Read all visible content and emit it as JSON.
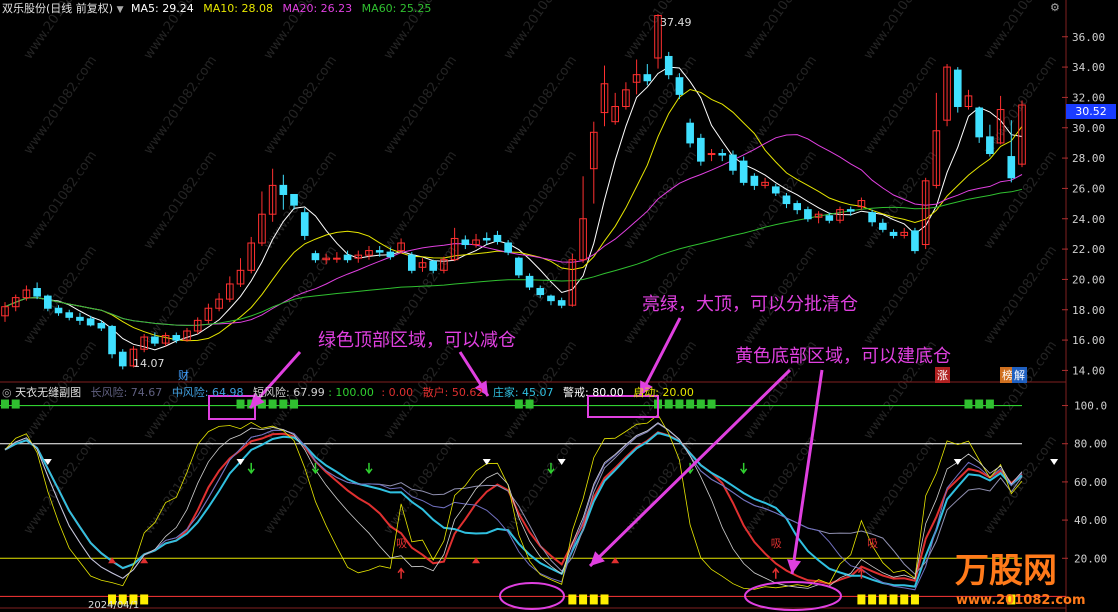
{
  "header": {
    "stock_title": "双乐股份(日线 前复权)",
    "ma5": "MA5: 29.24",
    "ma10": "MA10: 28.08",
    "ma20": "MA20: 26.23",
    "ma60": "MA60: 25.25"
  },
  "main_chart": {
    "y_ticks": [
      "36.00",
      "34.00",
      "32.00",
      "30.00",
      "28.00",
      "26.00",
      "24.00",
      "22.00",
      "20.00",
      "18.00",
      "16.00",
      "14.00"
    ],
    "current_price": "30.52",
    "high_label": "37.49",
    "low_label": "14.07",
    "caiwu_tag": "财",
    "zhang_tag": "涨",
    "bang_tag": "榜",
    "jie_tag": "解"
  },
  "indicator": {
    "title": "天衣无缝副图",
    "long_risk": "长风险: 74.67",
    "mid_risk": "中风险: 64.98",
    "short_risk": "短风险: 67.99",
    "val1": ": 100.00",
    "val2": ": 0.00",
    "retail": "散户: 50.62",
    "banker": "庄家: 45.07",
    "warn": "警戒: 80.00",
    "start": "启动: 20.00",
    "y_ticks": [
      "100.0",
      "80.00",
      "60.00",
      "40.00",
      "20.00"
    ],
    "xi1": "吸",
    "xi2": "吸",
    "xi3": "吸",
    "bottom_date": "2024/04/1"
  },
  "annotations": {
    "green_top": "绿色顶部区域，可以减仓",
    "bright_green": "亮绿，大顶，可以分批清仓",
    "yellow_bottom": "黄色底部区域，可以建底仓"
  },
  "watermark": {
    "brand": "万股网",
    "url": "www.201082.com"
  },
  "colors": {
    "bg": "#000000",
    "ma5": "#ffffff",
    "ma10": "#e6e600",
    "ma20": "#e040e0",
    "ma60": "#30c030",
    "up_candle": "#ff3030",
    "down_candle": "#40e0ff",
    "annotation": "#e040e0"
  },
  "chart_data": {
    "type": "candlestick",
    "y_range": [
      13.5,
      37.5
    ],
    "candles": [
      [
        17.6,
        18.2,
        17.2,
        18.5
      ],
      [
        18.2,
        18.8,
        17.9,
        19.0
      ],
      [
        18.8,
        19.3,
        18.6,
        19.6
      ],
      [
        19.4,
        18.9,
        18.7,
        19.8
      ],
      [
        18.9,
        18.1,
        17.9,
        19.0
      ],
      [
        18.1,
        17.8,
        17.6,
        18.3
      ],
      [
        17.8,
        17.5,
        17.3,
        18.0
      ],
      [
        17.5,
        17.3,
        17.0,
        17.8
      ],
      [
        17.4,
        17.0,
        16.9,
        17.6
      ],
      [
        17.1,
        16.8,
        16.6,
        17.3
      ],
      [
        16.9,
        15.1,
        14.8,
        17.0
      ],
      [
        15.2,
        14.3,
        14.07,
        15.4
      ],
      [
        14.3,
        15.4,
        14.2,
        15.6
      ],
      [
        15.4,
        16.2,
        15.2,
        16.4
      ],
      [
        16.2,
        15.8,
        15.6,
        16.5
      ],
      [
        15.8,
        16.3,
        15.6,
        16.5
      ],
      [
        16.3,
        16.0,
        15.8,
        16.5
      ],
      [
        16.0,
        16.6,
        15.9,
        16.8
      ],
      [
        16.6,
        17.3,
        16.4,
        17.5
      ],
      [
        17.3,
        18.1,
        17.1,
        18.4
      ],
      [
        18.1,
        18.7,
        17.9,
        19.1
      ],
      [
        18.7,
        19.7,
        18.5,
        20.2
      ],
      [
        19.7,
        20.6,
        19.5,
        21.4
      ],
      [
        20.6,
        22.4,
        20.4,
        22.8
      ],
      [
        22.4,
        24.3,
        22.2,
        25.8
      ],
      [
        24.3,
        26.2,
        23.8,
        27.3
      ],
      [
        26.2,
        25.6,
        24.6,
        26.9
      ],
      [
        25.6,
        24.9,
        24.6,
        25.4
      ],
      [
        24.4,
        22.9,
        22.6,
        24.7
      ],
      [
        21.7,
        21.3,
        21.1,
        21.9
      ],
      [
        21.3,
        21.4,
        21.0,
        21.7
      ],
      [
        21.4,
        21.4,
        21.1,
        21.8
      ],
      [
        21.6,
        21.3,
        21.1,
        21.9
      ],
      [
        21.4,
        21.6,
        21.1,
        21.9
      ],
      [
        21.6,
        21.9,
        21.3,
        22.2
      ],
      [
        21.9,
        21.8,
        21.5,
        22.2
      ],
      [
        21.8,
        21.5,
        21.3,
        22.1
      ],
      [
        21.9,
        22.4,
        21.7,
        22.7
      ],
      [
        21.6,
        20.6,
        20.4,
        21.8
      ],
      [
        20.8,
        21.1,
        20.5,
        21.4
      ],
      [
        21.2,
        20.6,
        20.4,
        21.3
      ],
      [
        20.6,
        21.3,
        20.4,
        21.5
      ],
      [
        21.3,
        22.7,
        21.2,
        23.4
      ],
      [
        22.6,
        22.3,
        22.0,
        22.9
      ],
      [
        22.3,
        22.6,
        22.1,
        23.0
      ],
      [
        22.7,
        22.6,
        22.3,
        23.1
      ],
      [
        22.9,
        22.5,
        22.3,
        23.2
      ],
      [
        22.4,
        21.8,
        21.6,
        22.6
      ],
      [
        21.4,
        20.3,
        20.1,
        21.5
      ],
      [
        20.2,
        19.5,
        19.3,
        20.4
      ],
      [
        19.4,
        19.0,
        18.8,
        19.6
      ],
      [
        18.9,
        18.6,
        18.3,
        19.0
      ],
      [
        18.6,
        18.3,
        18.1,
        18.8
      ],
      [
        18.3,
        21.3,
        18.2,
        21.7
      ],
      [
        21.3,
        24.0,
        21.1,
        26.8
      ],
      [
        27.3,
        29.7,
        25.0,
        30.4
      ],
      [
        31.0,
        32.9,
        30.1,
        34.1
      ],
      [
        30.4,
        31.4,
        30.2,
        32.3
      ],
      [
        31.4,
        32.5,
        31.2,
        33.0
      ],
      [
        33.0,
        33.5,
        32.2,
        34.5
      ],
      [
        33.5,
        33.1,
        32.8,
        34.2
      ],
      [
        34.6,
        37.4,
        33.9,
        37.49
      ],
      [
        34.7,
        33.5,
        33.2,
        35.0
      ],
      [
        33.3,
        32.2,
        31.9,
        33.6
      ],
      [
        30.3,
        29.0,
        28.7,
        30.6
      ],
      [
        29.3,
        27.8,
        27.5,
        29.6
      ],
      [
        28.3,
        28.3,
        27.8,
        28.6
      ],
      [
        28.3,
        28.2,
        27.8,
        28.6
      ],
      [
        28.2,
        27.2,
        26.9,
        28.5
      ],
      [
        27.8,
        26.4,
        26.2,
        28.1
      ],
      [
        26.8,
        26.2,
        25.9,
        27.0
      ],
      [
        26.2,
        26.4,
        26.0,
        26.7
      ],
      [
        26.1,
        25.7,
        25.5,
        26.3
      ],
      [
        25.5,
        25.0,
        24.7,
        25.7
      ],
      [
        25.0,
        24.6,
        24.3,
        25.2
      ],
      [
        24.6,
        24.0,
        23.8,
        24.8
      ],
      [
        24.1,
        24.3,
        23.7,
        24.5
      ],
      [
        24.2,
        23.9,
        23.7,
        24.4
      ],
      [
        23.9,
        24.6,
        23.7,
        24.8
      ],
      [
        24.6,
        24.5,
        24.2,
        24.8
      ],
      [
        24.8,
        25.2,
        24.6,
        25.4
      ],
      [
        24.4,
        23.8,
        23.5,
        24.6
      ],
      [
        23.7,
        23.3,
        23.1,
        24.0
      ],
      [
        23.1,
        22.9,
        22.7,
        23.3
      ],
      [
        22.9,
        23.1,
        22.7,
        23.4
      ],
      [
        23.2,
        21.9,
        21.7,
        23.4
      ],
      [
        22.3,
        26.5,
        22.0,
        26.7
      ],
      [
        26.2,
        29.8,
        26.0,
        32.3
      ],
      [
        30.5,
        34.0,
        30.1,
        34.2
      ],
      [
        33.8,
        31.4,
        31.0,
        34.0
      ],
      [
        31.4,
        32.1,
        31.2,
        32.5
      ],
      [
        31.3,
        29.4,
        29.0,
        31.4
      ],
      [
        29.4,
        28.3,
        28.1,
        30.2
      ],
      [
        29.0,
        31.2,
        28.9,
        32.1
      ],
      [
        28.1,
        26.7,
        26.4,
        30.5
      ],
      [
        27.6,
        31.5,
        27.4,
        31.8
      ]
    ]
  }
}
